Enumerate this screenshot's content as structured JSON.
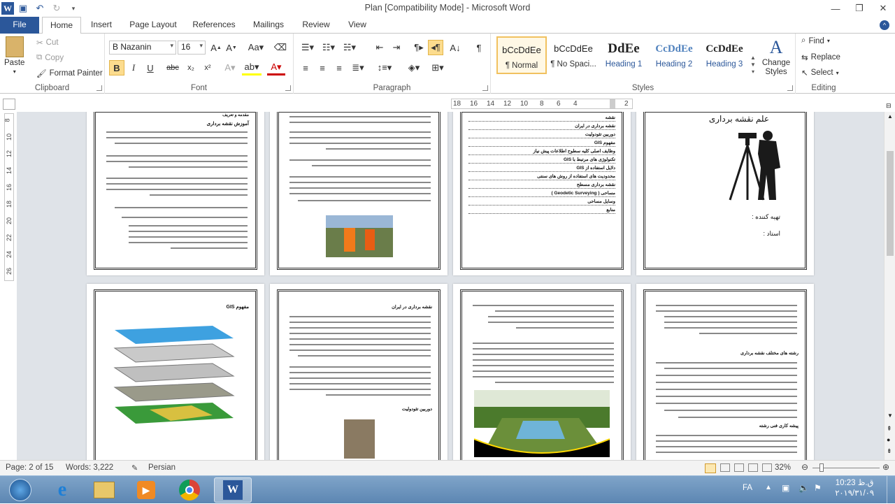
{
  "window": {
    "title": "Plan [Compatibility Mode] - Microsoft Word"
  },
  "tabs": [
    "File",
    "Home",
    "Insert",
    "Page Layout",
    "References",
    "Mailings",
    "Review",
    "View"
  ],
  "clipboard": {
    "paste": "Paste",
    "cut": "Cut",
    "copy": "Copy",
    "format_painter": "Format Painter",
    "label": "Clipboard"
  },
  "font": {
    "name": "B Nazanin",
    "size": "16",
    "label": "Font",
    "bold": "B",
    "italic": "I",
    "underline": "U",
    "strike": "abc",
    "sub": "x₂",
    "sup": "x²"
  },
  "paragraph": {
    "label": "Paragraph"
  },
  "styles": {
    "label": "Styles",
    "items": [
      {
        "sample": "bCcDdEe",
        "name": "¶ Normal"
      },
      {
        "sample": "bCcDdEe",
        "name": "¶ No Spaci..."
      },
      {
        "sample": "DdEe",
        "name": "Heading 1"
      },
      {
        "sample": "CcDdEe",
        "name": "Heading 2"
      },
      {
        "sample": "CcDdEe",
        "name": "Heading 3"
      }
    ],
    "change": "Change Styles"
  },
  "editing": {
    "label": "Editing",
    "find": "Find",
    "replace": "Replace",
    "select": "Select"
  },
  "ruler": {
    "marks": [
      "18",
      "16",
      "14",
      "12",
      "10",
      "8",
      "6",
      "4",
      "2"
    ]
  },
  "ruler_v": {
    "marks": [
      "8",
      "10",
      "12",
      "14",
      "16",
      "18",
      "20",
      "22",
      "24",
      "26"
    ]
  },
  "pages": {
    "p1_title": "آموزش نقشه برداری",
    "p1_heading": "مقدمه و تعریف",
    "p4_title": "علم نقشه برداری",
    "p4_prepared": "تهیه کننده :",
    "p4_teacher": "استاد :",
    "p3_toc": [
      "نقشه",
      "نقشه برداری در ایران",
      "دوربین تئودولیت",
      "مفهوم GIS",
      "وظایف اصلی کلیه سطوح اطلاعات پیش نیاز",
      "تکنولوژی های مرتبط با GIS",
      "دلایل استفاده از GIS",
      "محدودیت های استفاده از روش های سنتی",
      "نقشه برداری مسطح",
      "مساحی ( Geodetic Surveying )",
      "وسایل مساحی",
      "منابع"
    ],
    "p5_title": "مفهوم GIS",
    "p6_title": "نقشه برداری در ایران",
    "p6_sub": "دوربین تئودولیت",
    "p8_title": "رشته های مختلف نقشه برداری",
    "p8_sub": "پیشه کاری فنی رشته"
  },
  "status": {
    "page": "Page: 2 of 15",
    "words": "Words: 3,222",
    "lang": "Persian",
    "zoom": "32%"
  },
  "tray": {
    "lang": "FA",
    "time": "10:23 ق.ظ",
    "date": "۲۰۱۹/۳۱/۰۹"
  }
}
